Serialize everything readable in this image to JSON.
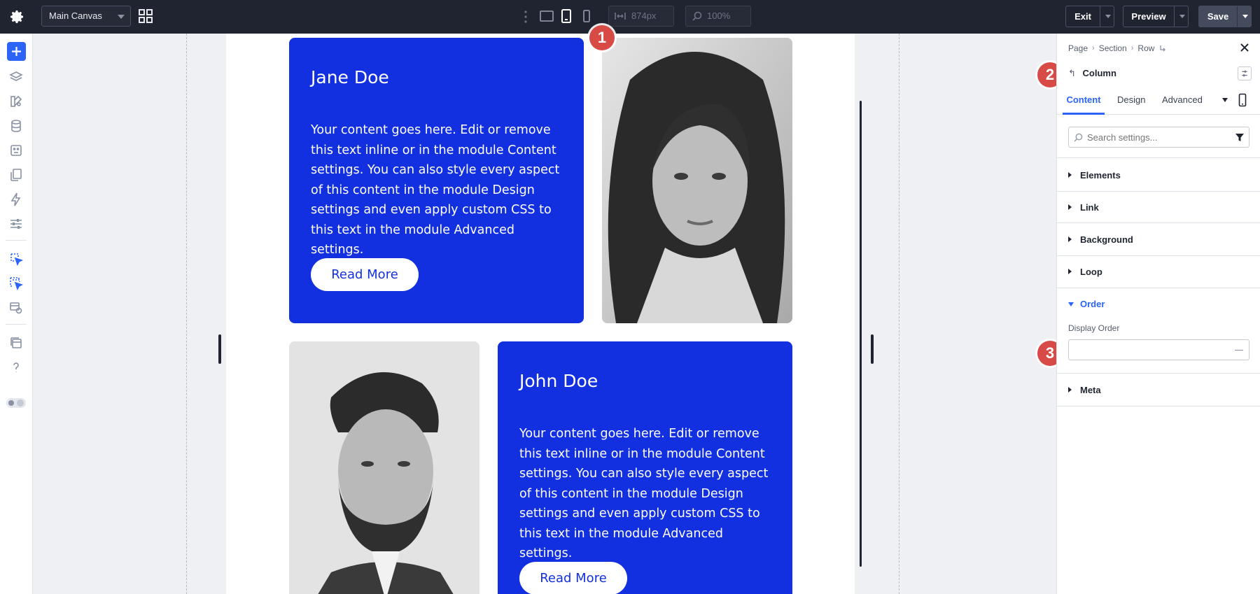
{
  "topbar": {
    "canvas_select": "Main Canvas",
    "width_value": "874px",
    "zoom_value": "100%",
    "exit_label": "Exit",
    "preview_label": "Preview",
    "save_label": "Save"
  },
  "cards": [
    {
      "name": "Jane Doe",
      "body": "Your content goes here. Edit or remove this text inline or in the module Content settings. You can also style every aspect of this content in the module Design settings and even apply custom CSS to this text in the module Advanced settings.",
      "button": "Read More"
    },
    {
      "name": "John Doe",
      "body": "Your content goes here. Edit or remove this text inline or in the module Content settings. You can also style every aspect of this content in the module Design settings and even apply custom CSS to this text in the module Advanced settings.",
      "button": "Read More"
    }
  ],
  "badges": [
    "1",
    "2",
    "3"
  ],
  "panel": {
    "breadcrumbs": [
      "Page",
      "Section",
      "Row"
    ],
    "title": "Column",
    "tabs": [
      "Content",
      "Design",
      "Advanced"
    ],
    "active_tab": "Content",
    "search_placeholder": "Search settings...",
    "sections": [
      "Elements",
      "Link",
      "Background",
      "Loop",
      "Order",
      "Meta"
    ],
    "open_section": "Order",
    "order_field_label": "Display Order",
    "order_field_value": ""
  },
  "colors": {
    "accent": "#2b64f6",
    "card_blue": "#1330e0",
    "topbar": "#1f2430",
    "badge": "#d84a45"
  }
}
